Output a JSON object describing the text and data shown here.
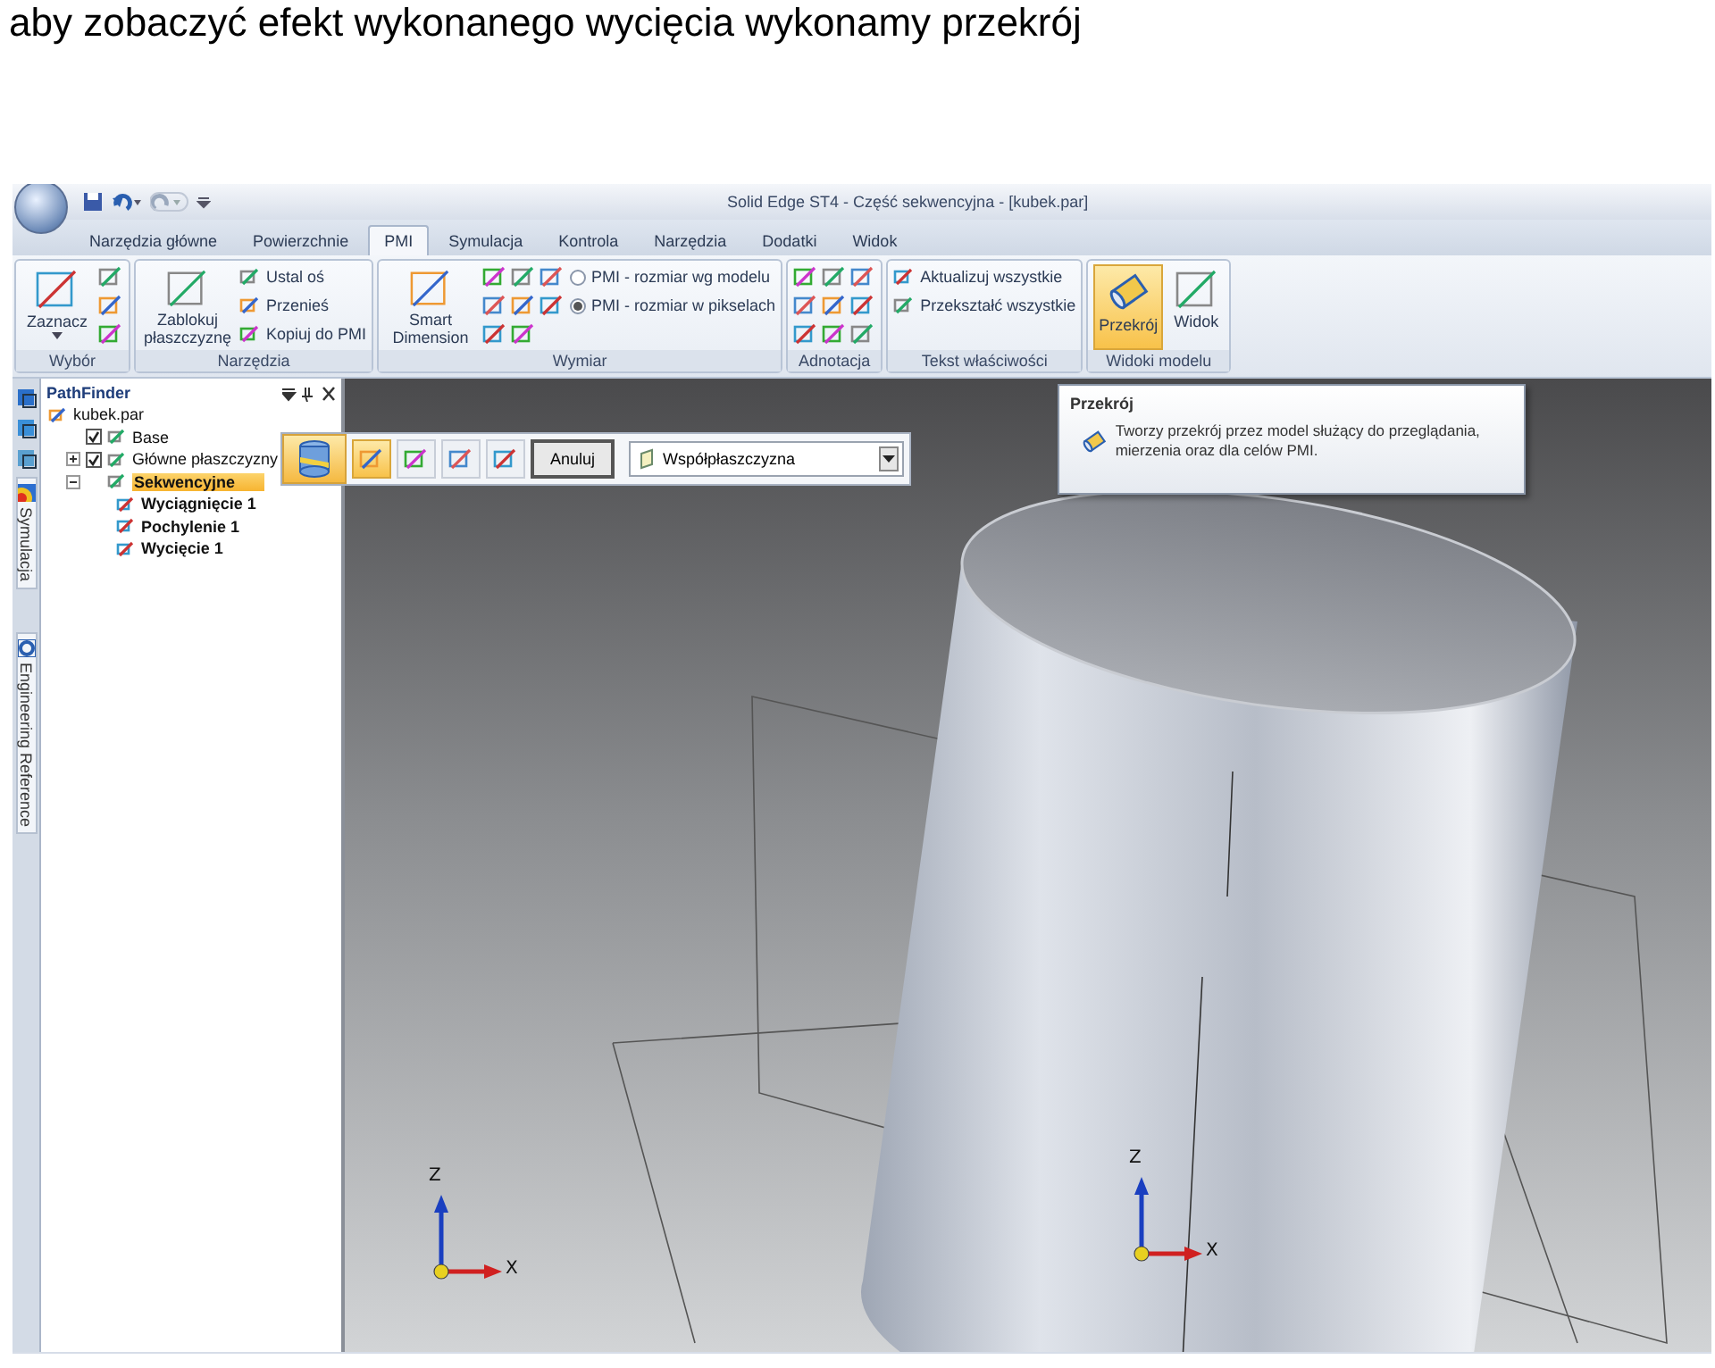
{
  "caption": "aby zobaczyć efekt wykonanego wycięcia wykonamy przekrój",
  "window": {
    "title": "Solid Edge ST4 - Część sekwencyjna - [kubek.par]"
  },
  "tabs": [
    {
      "label": "Narzędzia główne",
      "selected": false
    },
    {
      "label": "Powierzchnie",
      "selected": false
    },
    {
      "label": "PMI",
      "selected": true
    },
    {
      "label": "Symulacja",
      "selected": false
    },
    {
      "label": "Kontrola",
      "selected": false
    },
    {
      "label": "Narzędzia",
      "selected": false
    },
    {
      "label": "Dodatki",
      "selected": false
    },
    {
      "label": "Widok",
      "selected": false
    }
  ],
  "ribbon_groups": [
    {
      "label": "Wybór",
      "items": [
        {
          "kind": "large",
          "label": "Zaznacz",
          "dropdown": true
        },
        {
          "kind": "icon"
        },
        {
          "kind": "icon"
        },
        {
          "kind": "icon"
        }
      ]
    },
    {
      "label": "Narzędzia",
      "items": [
        {
          "kind": "large",
          "label": "Zablokuj płaszczyznę"
        },
        {
          "kind": "small",
          "label": "Ustal oś"
        },
        {
          "kind": "small",
          "label": "Przenieś"
        },
        {
          "kind": "small",
          "label": "Kopiuj do PMI"
        }
      ]
    },
    {
      "label": "Wymiar",
      "items": [
        {
          "kind": "large",
          "label": "Smart Dimension"
        },
        {
          "kind": "icon"
        },
        {
          "kind": "icon"
        },
        {
          "kind": "icon"
        },
        {
          "kind": "icon"
        },
        {
          "kind": "icon"
        },
        {
          "kind": "icon"
        },
        {
          "kind": "icon"
        },
        {
          "kind": "icon"
        },
        {
          "kind": "radio",
          "label": "PMI - rozmiar wg modelu",
          "selected": false
        },
        {
          "kind": "radio",
          "label": "PMI - rozmiar w pikselach",
          "selected": true
        }
      ]
    },
    {
      "label": "Adnotacja",
      "items": [
        {
          "kind": "icon"
        },
        {
          "kind": "icon"
        },
        {
          "kind": "icon"
        },
        {
          "kind": "icon"
        },
        {
          "kind": "icon"
        },
        {
          "kind": "icon"
        },
        {
          "kind": "icon"
        },
        {
          "kind": "icon"
        },
        {
          "kind": "icon"
        }
      ]
    },
    {
      "label": "Tekst właściwości",
      "items": [
        {
          "kind": "small",
          "label": "Aktualizuj wszystkie"
        },
        {
          "kind": "small",
          "label": "Przekształć wszystkie"
        }
      ]
    },
    {
      "label": "Widoki modelu",
      "items": [
        {
          "kind": "large",
          "label": "Przekrój",
          "selected": true
        },
        {
          "kind": "large",
          "label": "Widok",
          "selected": false
        }
      ]
    }
  ],
  "side_tabs": [
    {
      "label": "Symulacja"
    },
    {
      "label": "Engineering Reference"
    }
  ],
  "pathfinder": {
    "title": "PathFinder",
    "tree": [
      {
        "label": "kubek.par",
        "selected": false,
        "children": [
          {
            "label": "Base",
            "checked": true,
            "selected": false
          },
          {
            "label": "Główne płaszczyzny",
            "checked": true,
            "expanded": false,
            "selected": false
          },
          {
            "label": "Sekwencyjne",
            "expanded": true,
            "selected": true,
            "children": [
              {
                "label": "Wyciągnięcie 1",
                "selected": false
              },
              {
                "label": "Pochylenie 1",
                "selected": false
              },
              {
                "label": "Wycięcie 1",
                "selected": false
              }
            ]
          }
        ]
      }
    ]
  },
  "command_bar": {
    "options": [
      {
        "selected": true
      },
      {
        "selected": false
      },
      {
        "selected": false
      },
      {
        "selected": false
      }
    ],
    "cancel": "Anuluj",
    "dropdown": "Współpłaszczyzna"
  },
  "tooltip": {
    "title": "Przekrój",
    "text": "Tworzy przekrój przez model służący do przeglądania, mierzenia oraz dla celów PMI."
  },
  "axes": [
    {
      "vertical": "Z",
      "horizontal": "X"
    },
    {
      "vertical": "Z",
      "horizontal": "X"
    }
  ]
}
